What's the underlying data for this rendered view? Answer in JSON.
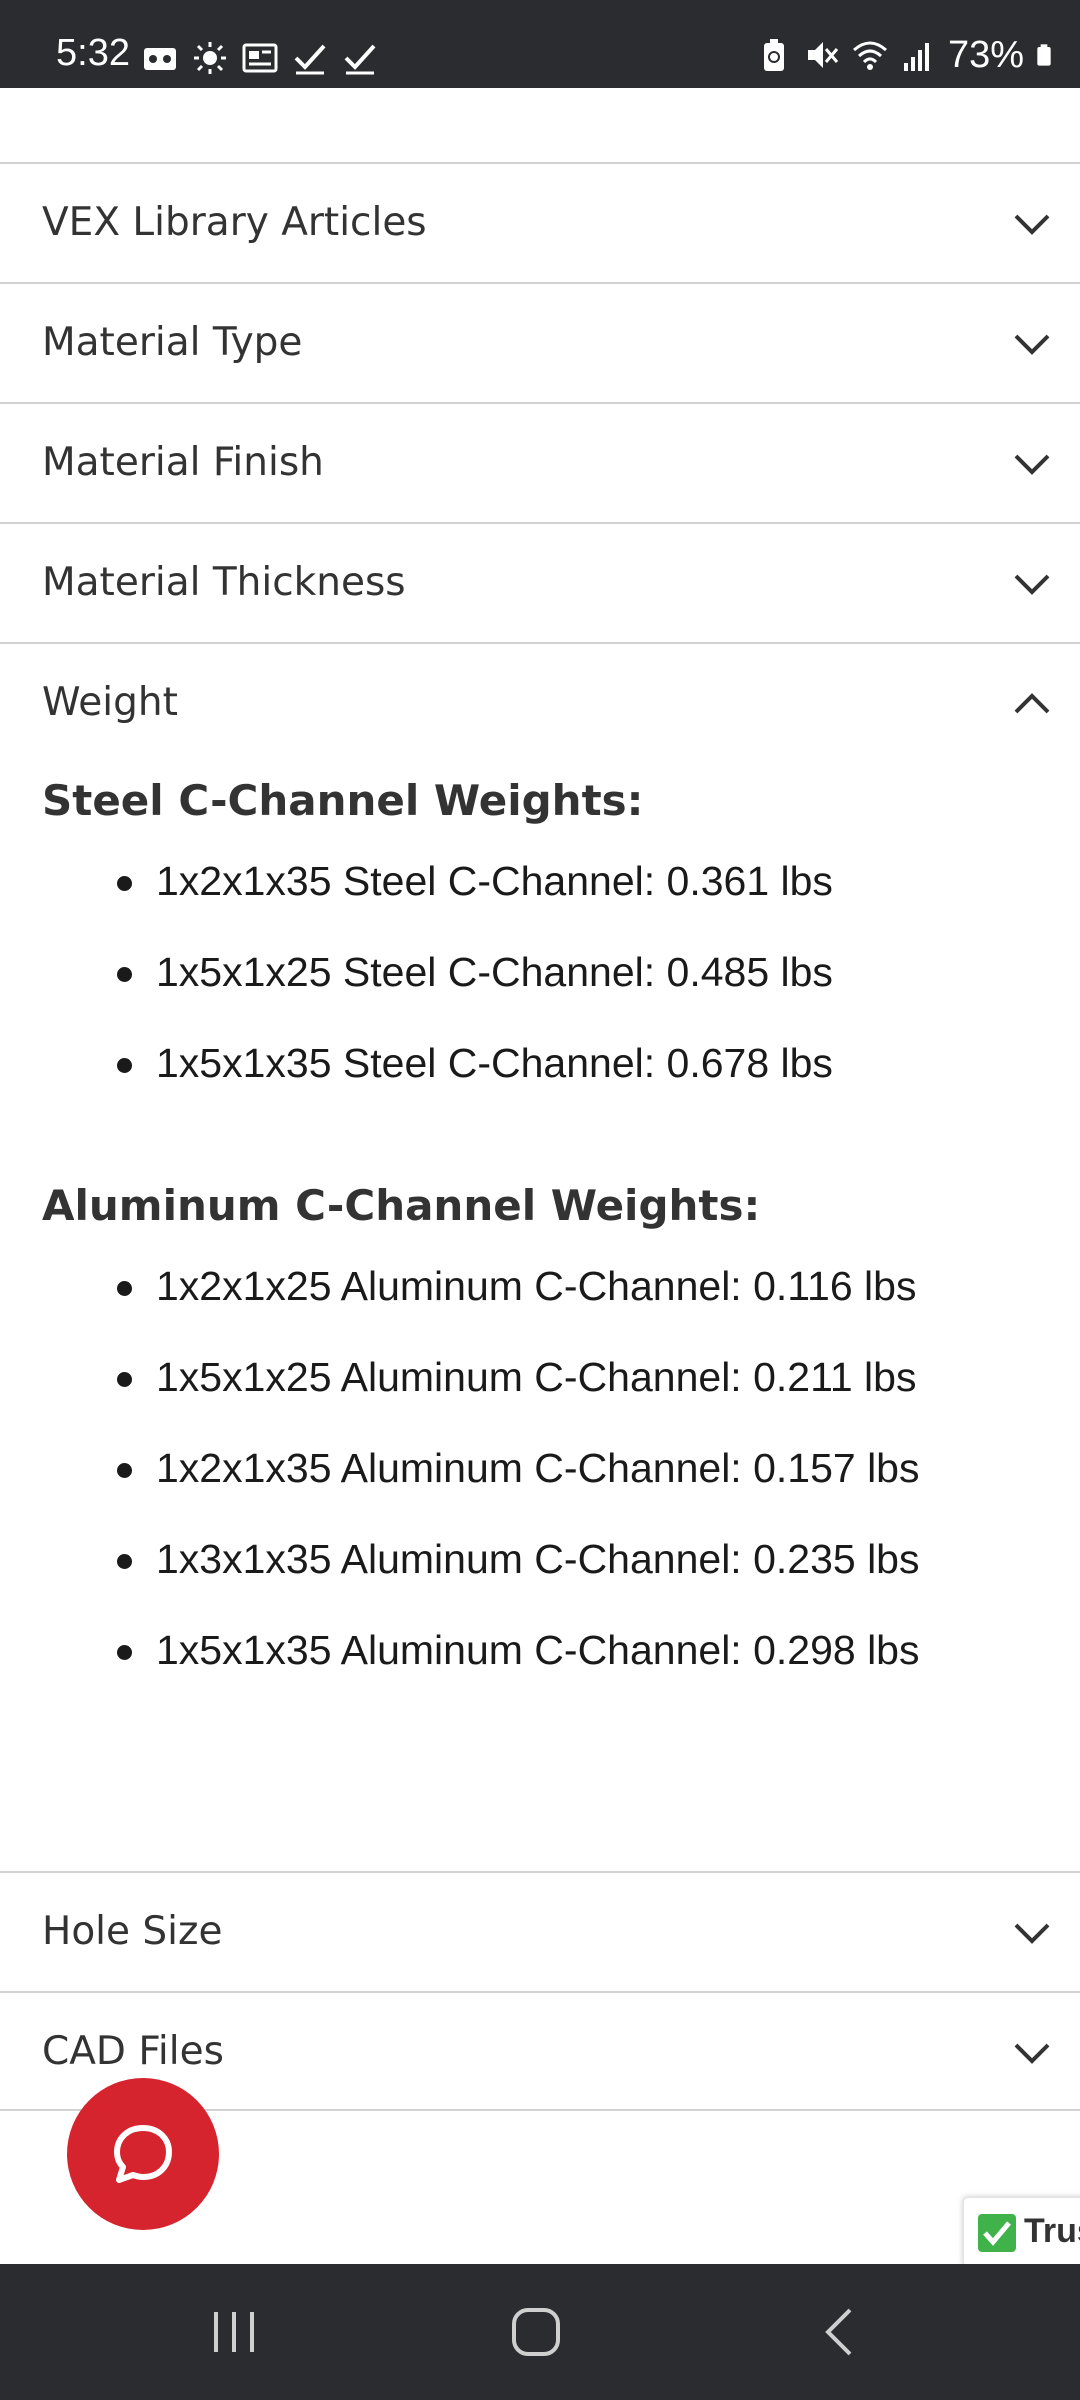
{
  "status_bar": {
    "time": "5:32",
    "battery": "73%",
    "left_icons": [
      "voicemail-icon",
      "brightness-icon",
      "news-icon",
      "check-icon",
      "check-icon"
    ],
    "right_icons": [
      "battery-saver-icon",
      "mute-icon",
      "wifi-icon",
      "signal-icon",
      "battery-icon"
    ]
  },
  "accordion": {
    "items_top": [
      {
        "label": "VEX Library Articles"
      },
      {
        "label": "Material Type"
      },
      {
        "label": "Material Finish"
      },
      {
        "label": "Material Thickness"
      }
    ],
    "weight": {
      "label": "Weight",
      "steel_heading": "Steel C-Channel Weights:",
      "steel_items": [
        "1x2x1x35 Steel C-Channel: 0.361 lbs",
        "1x5x1x25 Steel C-Channel: 0.485 lbs",
        "1x5x1x35 Steel C-Channel: 0.678 lbs"
      ],
      "aluminum_heading": "Aluminum C-Channel Weights:",
      "aluminum_items": [
        "1x2x1x25 Aluminum C-Channel: 0.116 lbs",
        "1x5x1x25 Aluminum C-Channel: 0.211 lbs",
        "1x2x1x35 Aluminum C-Channel: 0.157 lbs",
        "1x3x1x35 Aluminum C-Channel: 0.235 lbs",
        "1x5x1x35 Aluminum C-Channel: 0.298 lbs"
      ]
    },
    "items_bottom": [
      {
        "label": "Hole Size"
      },
      {
        "label": "CAD Files"
      }
    ]
  },
  "chat": {
    "icon": "chat-bubble-icon"
  },
  "trust_badge": {
    "text": "Trus"
  },
  "colors": {
    "accent_red": "#d6242f",
    "status_bar": "#2a2c30",
    "divider": "#d2d2d2",
    "trust_green": "#3fb24a"
  }
}
